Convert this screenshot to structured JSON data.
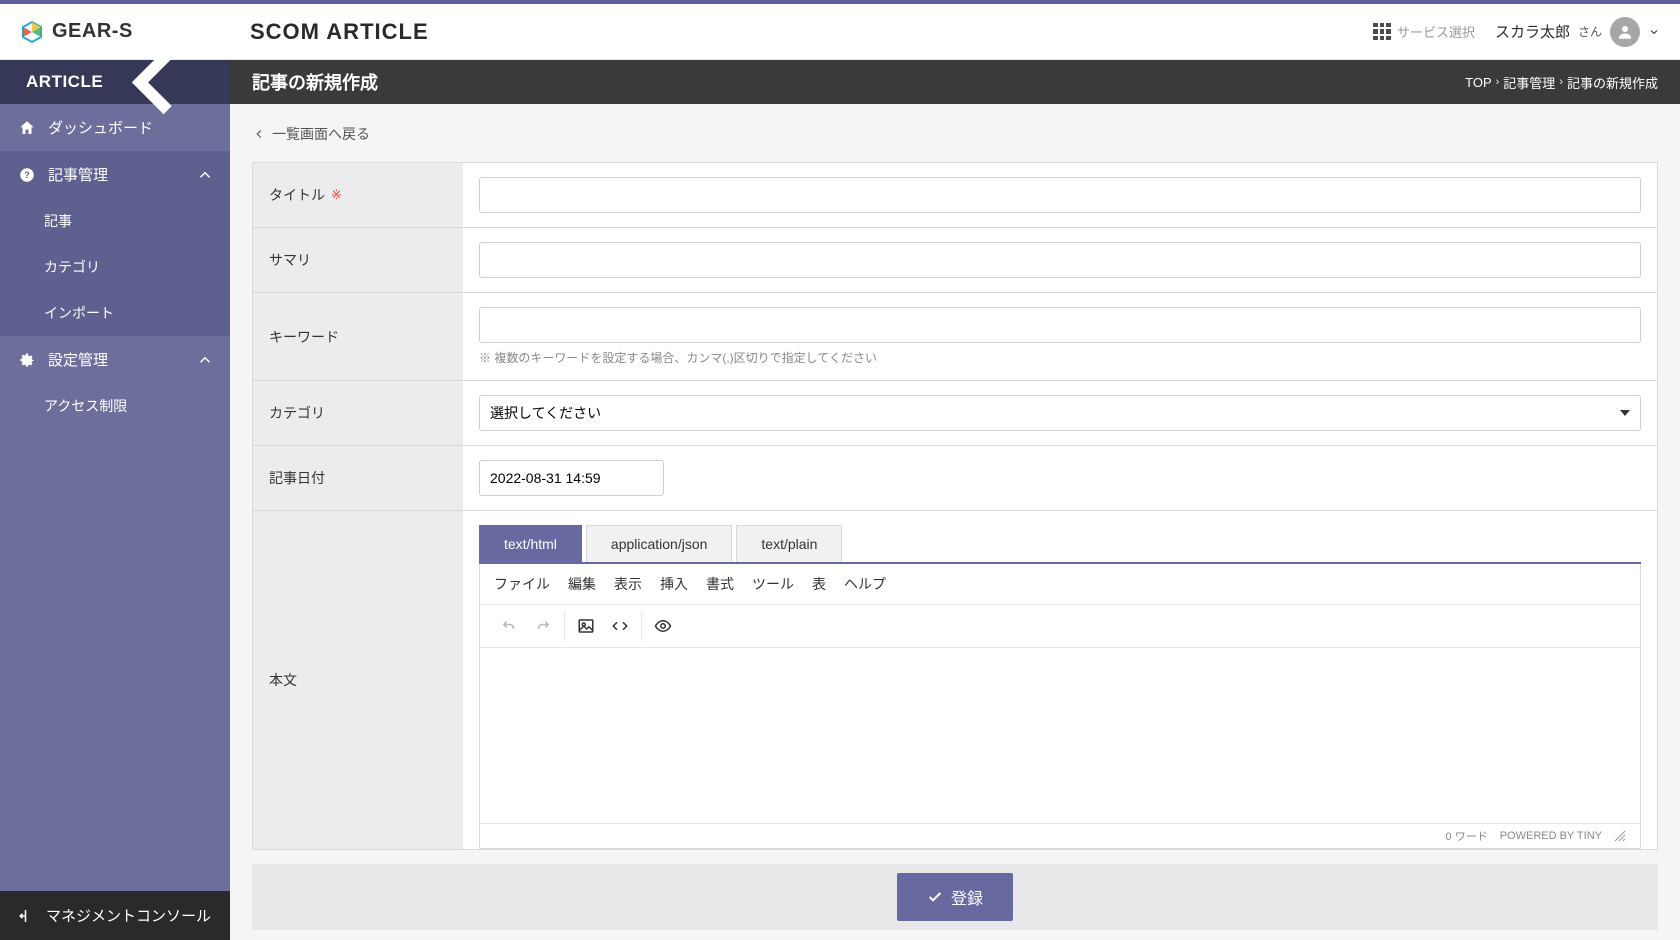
{
  "brand": {
    "name": "GEAR-S"
  },
  "app_title": "SCOM ARTICLE",
  "header": {
    "service_select": "サービス選択",
    "user_name": "スカラ太郎",
    "user_suffix": "さん"
  },
  "sidebar": {
    "title": "ARTICLE",
    "items": [
      {
        "icon": "home",
        "label": "ダッシュボード"
      },
      {
        "icon": "help",
        "label": "記事管理",
        "expanded": true,
        "children": [
          {
            "label": "記事"
          },
          {
            "label": "カテゴリ"
          },
          {
            "label": "インポート"
          }
        ]
      },
      {
        "icon": "gear",
        "label": "設定管理",
        "expanded": true,
        "children": [
          {
            "label": "アクセス制限"
          }
        ]
      }
    ],
    "footer": "マネジメントコンソール"
  },
  "page": {
    "title": "記事の新規作成",
    "breadcrumbs": [
      "TOP",
      "記事管理",
      "記事の新規作成"
    ],
    "back": "一覧画面へ戻る"
  },
  "form": {
    "title_label": "タイトル",
    "required_mark": "※",
    "summary_label": "サマリ",
    "keyword_label": "キーワード",
    "keyword_help": "※ 複数のキーワードを設定する場合、カンマ(,)区切りで指定してください",
    "category_label": "カテゴリ",
    "category_placeholder": "選択してください",
    "date_label": "記事日付",
    "date_value": "2022-08-31 14:59",
    "body_label": "本文"
  },
  "editor": {
    "tabs": [
      "text/html",
      "application/json",
      "text/plain"
    ],
    "menus": [
      "ファイル",
      "編集",
      "表示",
      "挿入",
      "書式",
      "ツール",
      "表",
      "ヘルプ"
    ],
    "wordcount": "0 ワード",
    "powered": "POWERED BY TINY"
  },
  "submit_label": "登録"
}
